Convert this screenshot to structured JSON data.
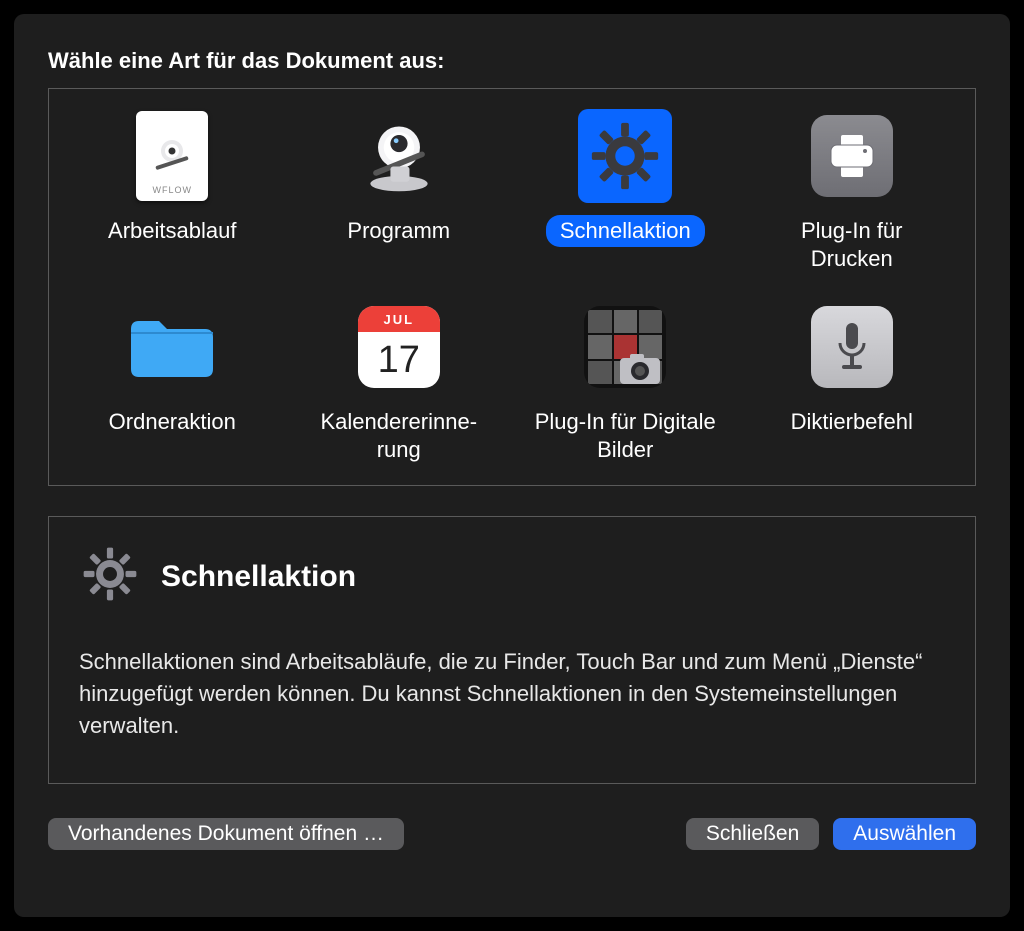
{
  "prompt": "Wähle eine Art für das Dokument aus:",
  "types": [
    {
      "id": "workflow",
      "label": "Arbeitsablauf",
      "selected": false
    },
    {
      "id": "program",
      "label": "Programm",
      "selected": false
    },
    {
      "id": "quickaction",
      "label": "Schnellaktion",
      "selected": true
    },
    {
      "id": "printplugin",
      "label": "Plug-In für Drucken",
      "selected": false
    },
    {
      "id": "folderaction",
      "label": "Ordneraktion",
      "selected": false
    },
    {
      "id": "calreminder",
      "label": "Kalendererinne-rung",
      "selected": false
    },
    {
      "id": "imageplugin",
      "label": "Plug-In für Digitale Bilder",
      "selected": false
    },
    {
      "id": "dictation",
      "label": "Diktierbefehl",
      "selected": false
    }
  ],
  "description": {
    "title": "Schnellaktion",
    "text": "Schnellaktionen sind Arbeitsabläufe, die zu Finder, Touch Bar und zum Menü „Dienste“ hinzugefügt werden können. Du kannst Schnellaktionen in den Systemeinstellungen verwalten."
  },
  "buttons": {
    "open_existing": "Vorhandenes Dokument öffnen …",
    "close": "Schließen",
    "choose": "Auswählen"
  },
  "wflow_caption": "WFLOW",
  "calendar": {
    "month": "JUL",
    "day": "17"
  }
}
